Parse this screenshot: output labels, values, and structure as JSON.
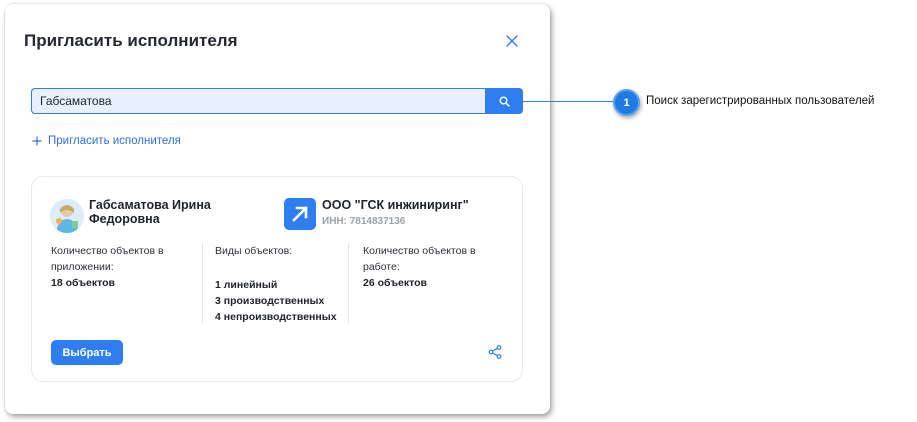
{
  "dialog": {
    "title": "Пригласить исполнителя",
    "close_icon": "close-icon"
  },
  "search": {
    "value": "Габсаматова",
    "button_icon": "search-icon"
  },
  "invite": {
    "icon": "plus-icon",
    "label": "Пригласить исполнителя"
  },
  "card": {
    "person": {
      "name": "Габсаматова Ирина Федоровна",
      "avatar_icon": "avatar"
    },
    "company": {
      "name": "ООО \"ГСК инжиниринг\"",
      "inn": "ИНН: 7814837136",
      "logo_icon": "company-logo-arrow-icon"
    },
    "stats": {
      "app_objects_label": "Количество объектов в приложении:",
      "app_objects_value": "18 объектов",
      "types_label": "Виды объектов:",
      "types": [
        "1 линейный",
        "3 производственных",
        "4 непроизводственных"
      ],
      "work_objects_label": "Количество объектов в работе:",
      "work_objects_value": "26 объектов"
    },
    "choose_label": "Выбрать",
    "share_icon": "share-icon"
  },
  "callout": {
    "number": "1",
    "text": "Поиск зарегистрированных пользователей"
  },
  "colors": {
    "accent": "#2f7ef0",
    "input_bg": "#e8f0fd",
    "callout": "#1e7be3"
  }
}
